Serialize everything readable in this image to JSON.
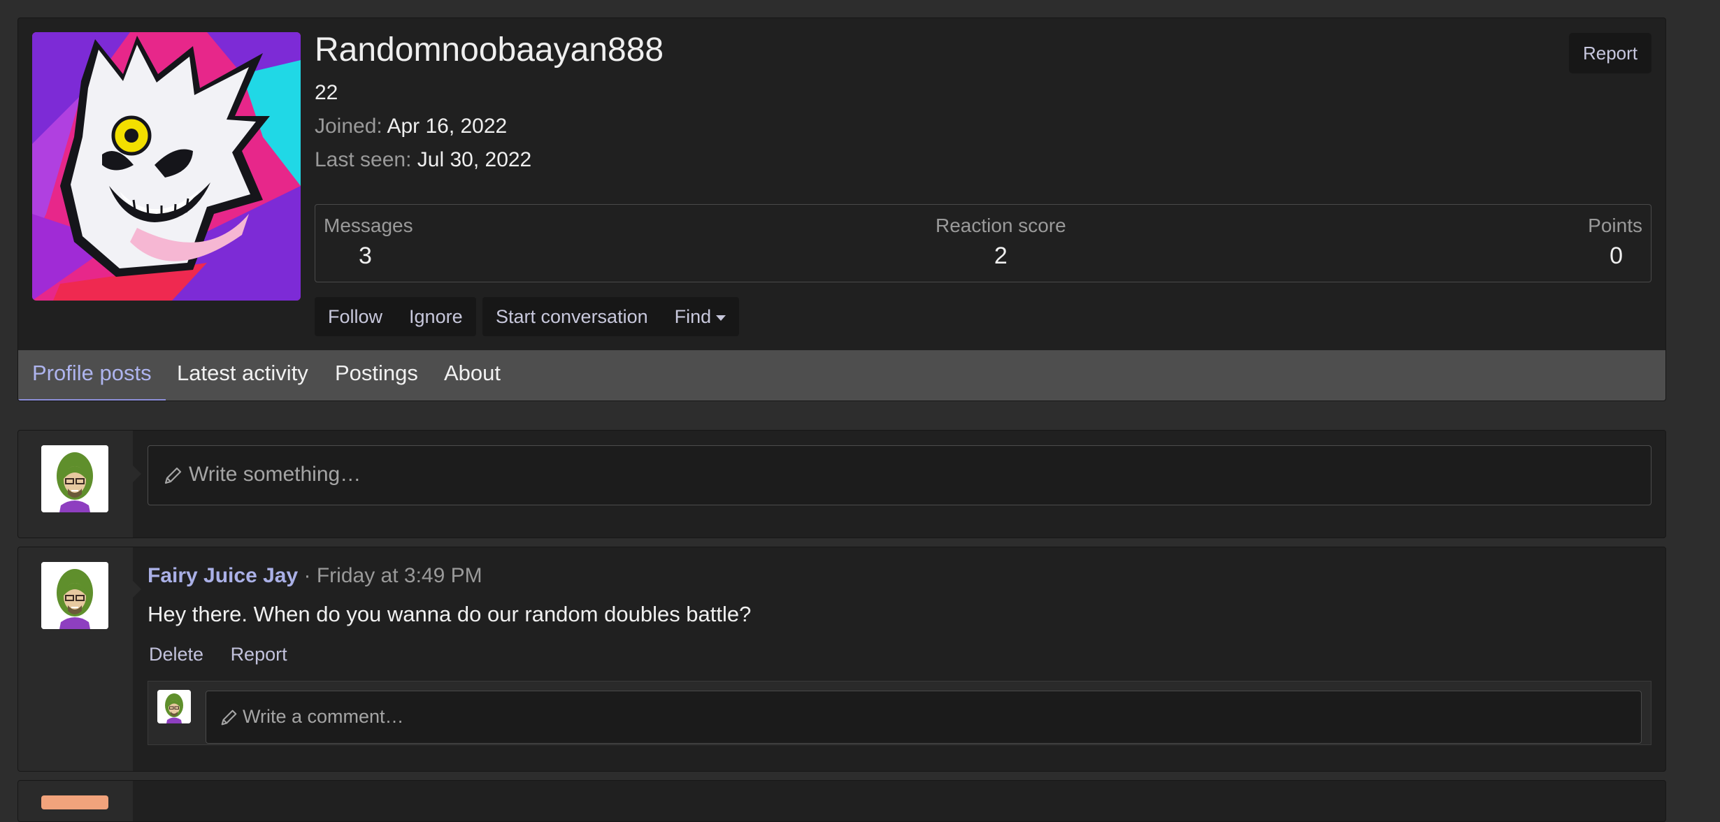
{
  "profile": {
    "username": "Randomnoobaayan888",
    "user_title": "22",
    "joined_label": "Joined:",
    "joined_value": "Apr 16, 2022",
    "last_seen_label": "Last seen:",
    "last_seen_value": "Jul 30, 2022",
    "report_label": "Report",
    "stats": [
      {
        "label": "Messages",
        "value": "3"
      },
      {
        "label": "Reaction score",
        "value": "2"
      },
      {
        "label": "Points",
        "value": "0"
      }
    ],
    "buttons": {
      "follow": "Follow",
      "ignore": "Ignore",
      "start_conversation": "Start conversation",
      "find": "Find"
    }
  },
  "tabs": [
    {
      "label": "Profile posts",
      "active": true
    },
    {
      "label": "Latest activity",
      "active": false
    },
    {
      "label": "Postings",
      "active": false
    },
    {
      "label": "About",
      "active": false
    }
  ],
  "composer": {
    "placeholder": "Write something…"
  },
  "posts": [
    {
      "author": "Fairy Juice Jay",
      "separator": "·",
      "time": "Friday at 3:49 PM",
      "body": "Hey there. When do you wanna do our random doubles battle?",
      "actions": {
        "delete": "Delete",
        "report": "Report"
      },
      "comment_placeholder": "Write a comment…"
    }
  ],
  "colors": {
    "page_bg": "#2d2d2d",
    "block_bg": "#202020",
    "accent": "#aab0e6",
    "tab_bar": "#4e4e4e"
  },
  "icons": [
    "pencil-icon",
    "caret-down-icon"
  ]
}
